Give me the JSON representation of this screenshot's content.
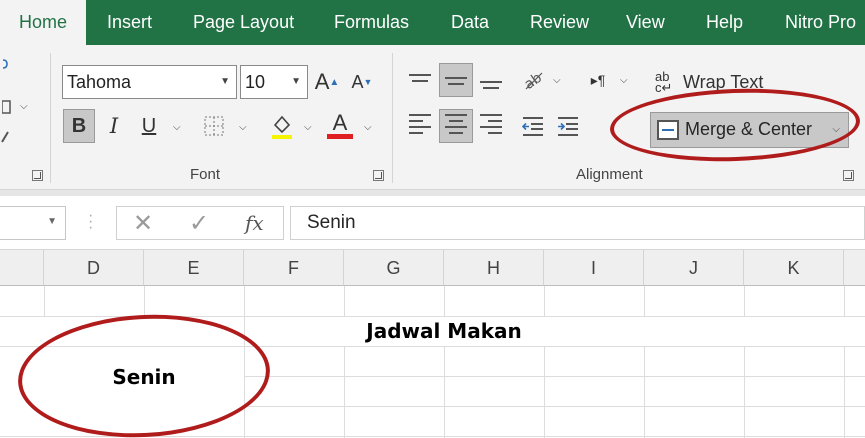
{
  "tabs": {
    "home": "Home",
    "insert": "Insert",
    "page_layout": "Page Layout",
    "formulas": "Formulas",
    "data": "Data",
    "review": "Review",
    "view": "View",
    "help": "Help",
    "nitro": "Nitro Pro"
  },
  "font_group": {
    "label": "Font",
    "font_name": "Tahoma",
    "font_size": "10",
    "bold": "B",
    "italic": "I",
    "underline": "U",
    "grow": "A",
    "shrink": "A",
    "font_color": "A"
  },
  "alignment_group": {
    "label": "Alignment",
    "wrap_text": "Wrap Text",
    "merge_center": "Merge & Center"
  },
  "formula_bar": {
    "cancel": "✕",
    "enter": "✓",
    "fx": "fx",
    "value": "Senin"
  },
  "columns": [
    "D",
    "E",
    "F",
    "G",
    "H",
    "I",
    "J",
    "K"
  ],
  "cells": {
    "title": "Jadwal Makan",
    "day": "Senin"
  },
  "colors": {
    "accent": "#217346",
    "annotation": "#b01c1c",
    "font_color_bar": "#e02020"
  },
  "icons": [
    "format-painter-icon",
    "borders-icon",
    "fill-color-icon",
    "orientation-icon",
    "paragraph-direction-icon",
    "indent-decrease-icon",
    "indent-increase-icon",
    "wrap-text-icon",
    "merge-icon",
    "dialog-launcher-icon"
  ]
}
